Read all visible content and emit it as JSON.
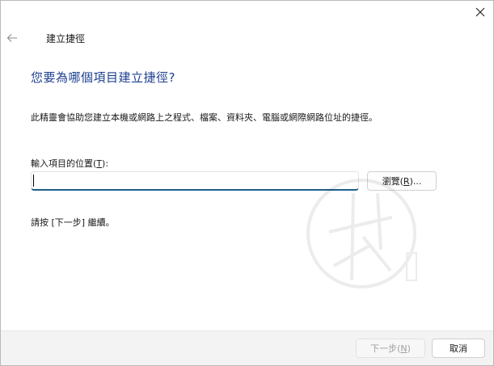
{
  "dialog": {
    "title": "建立捷徑"
  },
  "main": {
    "heading": "您要為哪個項目建立捷徑?",
    "description": "此精靈會協助您建立本機或網路上之程式、檔案、資料夾、電腦或網際網路位址的捷徑。",
    "input_label_prefix": "輸入項目的位置(",
    "input_label_key": "T",
    "input_label_suffix": "):",
    "location_value": "",
    "browse_label_prefix": "瀏覽(",
    "browse_label_key": "R",
    "browse_label_suffix": ")...",
    "hint": "請按 [下一步] 繼續。"
  },
  "footer": {
    "next_prefix": "下一步(",
    "next_key": "N",
    "next_suffix": ")",
    "next_enabled": false,
    "cancel_label": "取消"
  },
  "icons": {
    "close": "close-icon",
    "back": "back-arrow-icon"
  },
  "colors": {
    "heading": "#1c3f8f",
    "input_focus_underline": "#1f5f8b",
    "footer_bg": "#f3f3f3",
    "disabled_text": "#a0a0a0"
  }
}
